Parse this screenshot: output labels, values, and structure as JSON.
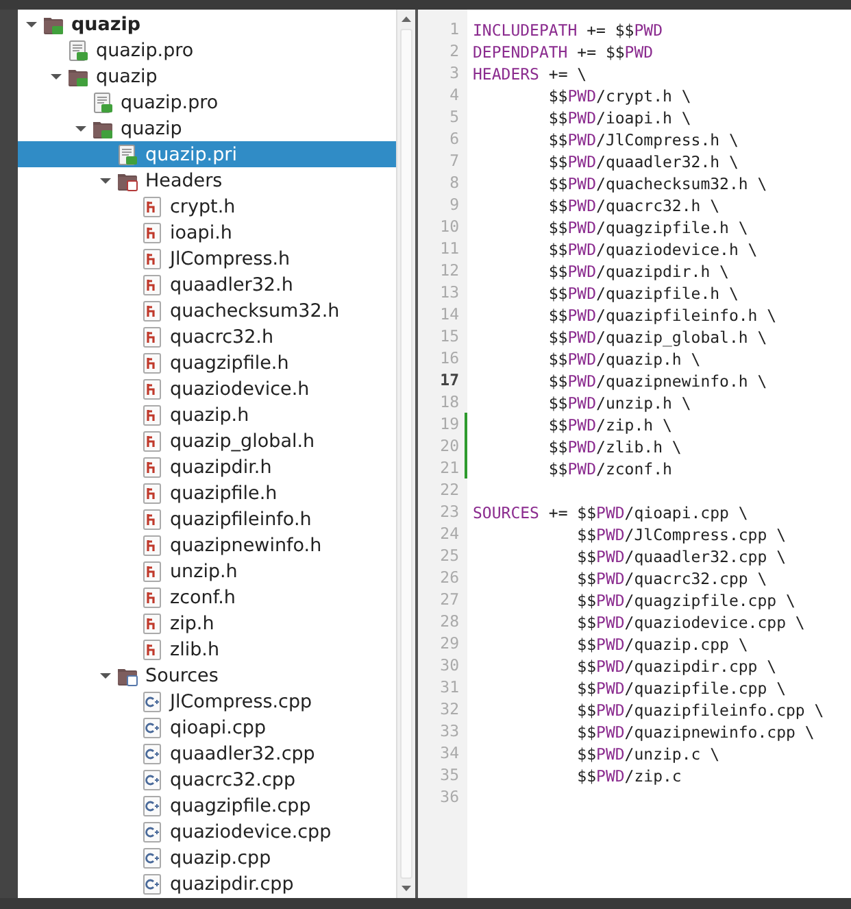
{
  "project_tree": [
    {
      "label": "quazip",
      "kind": "project",
      "bold": true,
      "expanded": true,
      "selected": false,
      "children": [
        {
          "label": "quazip.pro",
          "kind": "pro",
          "selected": false
        },
        {
          "label": "quazip",
          "kind": "project",
          "bold": false,
          "expanded": true,
          "selected": false,
          "children": [
            {
              "label": "quazip.pro",
              "kind": "pro",
              "selected": false
            },
            {
              "label": "quazip",
              "kind": "project",
              "bold": false,
              "expanded": true,
              "selected": false,
              "children": [
                {
                  "label": "quazip.pri",
                  "kind": "pro",
                  "selected": true
                },
                {
                  "label": "Headers",
                  "kind": "header-folder",
                  "bold": false,
                  "expanded": true,
                  "selected": false,
                  "children": [
                    {
                      "label": "crypt.h",
                      "kind": "header",
                      "selected": false
                    },
                    {
                      "label": "ioapi.h",
                      "kind": "header",
                      "selected": false
                    },
                    {
                      "label": "JlCompress.h",
                      "kind": "header",
                      "selected": false
                    },
                    {
                      "label": "quaadler32.h",
                      "kind": "header",
                      "selected": false
                    },
                    {
                      "label": "quachecksum32.h",
                      "kind": "header",
                      "selected": false
                    },
                    {
                      "label": "quacrc32.h",
                      "kind": "header",
                      "selected": false
                    },
                    {
                      "label": "quagzipfile.h",
                      "kind": "header",
                      "selected": false
                    },
                    {
                      "label": "quaziodevice.h",
                      "kind": "header",
                      "selected": false
                    },
                    {
                      "label": "quazip.h",
                      "kind": "header",
                      "selected": false
                    },
                    {
                      "label": "quazip_global.h",
                      "kind": "header",
                      "selected": false
                    },
                    {
                      "label": "quazipdir.h",
                      "kind": "header",
                      "selected": false
                    },
                    {
                      "label": "quazipfile.h",
                      "kind": "header",
                      "selected": false
                    },
                    {
                      "label": "quazipfileinfo.h",
                      "kind": "header",
                      "selected": false
                    },
                    {
                      "label": "quazipnewinfo.h",
                      "kind": "header",
                      "selected": false
                    },
                    {
                      "label": "unzip.h",
                      "kind": "header",
                      "selected": false
                    },
                    {
                      "label": "zconf.h",
                      "kind": "header",
                      "selected": false
                    },
                    {
                      "label": "zip.h",
                      "kind": "header",
                      "selected": false
                    },
                    {
                      "label": "zlib.h",
                      "kind": "header",
                      "selected": false
                    }
                  ]
                },
                {
                  "label": "Sources",
                  "kind": "source-folder",
                  "bold": false,
                  "expanded": true,
                  "selected": false,
                  "children": [
                    {
                      "label": "JlCompress.cpp",
                      "kind": "source",
                      "selected": false
                    },
                    {
                      "label": "qioapi.cpp",
                      "kind": "source",
                      "selected": false
                    },
                    {
                      "label": "quaadler32.cpp",
                      "kind": "source",
                      "selected": false
                    },
                    {
                      "label": "quacrc32.cpp",
                      "kind": "source",
                      "selected": false
                    },
                    {
                      "label": "quagzipfile.cpp",
                      "kind": "source",
                      "selected": false
                    },
                    {
                      "label": "quaziodevice.cpp",
                      "kind": "source",
                      "selected": false
                    },
                    {
                      "label": "quazip.cpp",
                      "kind": "source",
                      "selected": false
                    },
                    {
                      "label": "quazipdir.cpp",
                      "kind": "source",
                      "selected": false
                    }
                  ]
                }
              ]
            }
          ]
        }
      ]
    }
  ],
  "editor": {
    "lines": [
      {
        "number": "1",
        "current": false,
        "modified": false,
        "segments": [
          {
            "kind": "keyword",
            "text": "INCLUDEPATH"
          },
          {
            "kind": "plain",
            "text": " += $$"
          },
          {
            "kind": "keyword",
            "text": "PWD"
          }
        ]
      },
      {
        "number": "2",
        "current": false,
        "modified": false,
        "segments": [
          {
            "kind": "keyword",
            "text": "DEPENDPATH"
          },
          {
            "kind": "plain",
            "text": " += $$"
          },
          {
            "kind": "keyword",
            "text": "PWD"
          }
        ]
      },
      {
        "number": "3",
        "current": false,
        "modified": false,
        "segments": [
          {
            "kind": "keyword",
            "text": "HEADERS"
          },
          {
            "kind": "plain",
            "text": " += \\"
          }
        ]
      },
      {
        "number": "4",
        "current": false,
        "modified": false,
        "segments": [
          {
            "kind": "plain",
            "text": "        $$"
          },
          {
            "kind": "keyword",
            "text": "PWD"
          },
          {
            "kind": "plain",
            "text": "/crypt.h \\"
          }
        ]
      },
      {
        "number": "5",
        "current": false,
        "modified": false,
        "segments": [
          {
            "kind": "plain",
            "text": "        $$"
          },
          {
            "kind": "keyword",
            "text": "PWD"
          },
          {
            "kind": "plain",
            "text": "/ioapi.h \\"
          }
        ]
      },
      {
        "number": "6",
        "current": false,
        "modified": false,
        "segments": [
          {
            "kind": "plain",
            "text": "        $$"
          },
          {
            "kind": "keyword",
            "text": "PWD"
          },
          {
            "kind": "plain",
            "text": "/JlCompress.h \\"
          }
        ]
      },
      {
        "number": "7",
        "current": false,
        "modified": false,
        "segments": [
          {
            "kind": "plain",
            "text": "        $$"
          },
          {
            "kind": "keyword",
            "text": "PWD"
          },
          {
            "kind": "plain",
            "text": "/quaadler32.h \\"
          }
        ]
      },
      {
        "number": "8",
        "current": false,
        "modified": false,
        "segments": [
          {
            "kind": "plain",
            "text": "        $$"
          },
          {
            "kind": "keyword",
            "text": "PWD"
          },
          {
            "kind": "plain",
            "text": "/quachecksum32.h \\"
          }
        ]
      },
      {
        "number": "9",
        "current": false,
        "modified": false,
        "segments": [
          {
            "kind": "plain",
            "text": "        $$"
          },
          {
            "kind": "keyword",
            "text": "PWD"
          },
          {
            "kind": "plain",
            "text": "/quacrc32.h \\"
          }
        ]
      },
      {
        "number": "10",
        "current": false,
        "modified": false,
        "segments": [
          {
            "kind": "plain",
            "text": "        $$"
          },
          {
            "kind": "keyword",
            "text": "PWD"
          },
          {
            "kind": "plain",
            "text": "/quagzipfile.h \\"
          }
        ]
      },
      {
        "number": "11",
        "current": false,
        "modified": false,
        "segments": [
          {
            "kind": "plain",
            "text": "        $$"
          },
          {
            "kind": "keyword",
            "text": "PWD"
          },
          {
            "kind": "plain",
            "text": "/quaziodevice.h \\"
          }
        ]
      },
      {
        "number": "12",
        "current": false,
        "modified": false,
        "segments": [
          {
            "kind": "plain",
            "text": "        $$"
          },
          {
            "kind": "keyword",
            "text": "PWD"
          },
          {
            "kind": "plain",
            "text": "/quazipdir.h \\"
          }
        ]
      },
      {
        "number": "13",
        "current": false,
        "modified": false,
        "segments": [
          {
            "kind": "plain",
            "text": "        $$"
          },
          {
            "kind": "keyword",
            "text": "PWD"
          },
          {
            "kind": "plain",
            "text": "/quazipfile.h \\"
          }
        ]
      },
      {
        "number": "14",
        "current": false,
        "modified": false,
        "segments": [
          {
            "kind": "plain",
            "text": "        $$"
          },
          {
            "kind": "keyword",
            "text": "PWD"
          },
          {
            "kind": "plain",
            "text": "/quazipfileinfo.h \\"
          }
        ]
      },
      {
        "number": "15",
        "current": false,
        "modified": false,
        "segments": [
          {
            "kind": "plain",
            "text": "        $$"
          },
          {
            "kind": "keyword",
            "text": "PWD"
          },
          {
            "kind": "plain",
            "text": "/quazip_global.h \\"
          }
        ]
      },
      {
        "number": "16",
        "current": false,
        "modified": false,
        "segments": [
          {
            "kind": "plain",
            "text": "        $$"
          },
          {
            "kind": "keyword",
            "text": "PWD"
          },
          {
            "kind": "plain",
            "text": "/quazip.h \\"
          }
        ]
      },
      {
        "number": "17",
        "current": true,
        "modified": false,
        "segments": [
          {
            "kind": "plain",
            "text": "        $$"
          },
          {
            "kind": "keyword",
            "text": "PWD"
          },
          {
            "kind": "plain",
            "text": "/quazipnewinfo.h \\"
          }
        ]
      },
      {
        "number": "18",
        "current": false,
        "modified": false,
        "segments": [
          {
            "kind": "plain",
            "text": "        $$"
          },
          {
            "kind": "keyword",
            "text": "PWD"
          },
          {
            "kind": "plain",
            "text": "/unzip.h \\"
          }
        ]
      },
      {
        "number": "19",
        "current": false,
        "modified": true,
        "segments": [
          {
            "kind": "plain",
            "text": "        $$"
          },
          {
            "kind": "keyword",
            "text": "PWD"
          },
          {
            "kind": "plain",
            "text": "/zip.h \\"
          }
        ]
      },
      {
        "number": "20",
        "current": false,
        "modified": true,
        "segments": [
          {
            "kind": "plain",
            "text": "        $$"
          },
          {
            "kind": "keyword",
            "text": "PWD"
          },
          {
            "kind": "plain",
            "text": "/zlib.h \\"
          }
        ]
      },
      {
        "number": "21",
        "current": false,
        "modified": true,
        "segments": [
          {
            "kind": "plain",
            "text": "        $$"
          },
          {
            "kind": "keyword",
            "text": "PWD"
          },
          {
            "kind": "plain",
            "text": "/zconf.h"
          }
        ]
      },
      {
        "number": "22",
        "current": false,
        "modified": false
      },
      {
        "number": "23",
        "current": false,
        "modified": false,
        "segments": [
          {
            "kind": "keyword",
            "text": "SOURCES"
          },
          {
            "kind": "plain",
            "text": " += $$"
          },
          {
            "kind": "keyword",
            "text": "PWD"
          },
          {
            "kind": "plain",
            "text": "/qioapi.cpp \\"
          }
        ]
      },
      {
        "number": "24",
        "current": false,
        "modified": false,
        "segments": [
          {
            "kind": "plain",
            "text": "           $$"
          },
          {
            "kind": "keyword",
            "text": "PWD"
          },
          {
            "kind": "plain",
            "text": "/JlCompress.cpp \\"
          }
        ]
      },
      {
        "number": "25",
        "current": false,
        "modified": false,
        "segments": [
          {
            "kind": "plain",
            "text": "           $$"
          },
          {
            "kind": "keyword",
            "text": "PWD"
          },
          {
            "kind": "plain",
            "text": "/quaadler32.cpp \\"
          }
        ]
      },
      {
        "number": "26",
        "current": false,
        "modified": false,
        "segments": [
          {
            "kind": "plain",
            "text": "           $$"
          },
          {
            "kind": "keyword",
            "text": "PWD"
          },
          {
            "kind": "plain",
            "text": "/quacrc32.cpp \\"
          }
        ]
      },
      {
        "number": "27",
        "current": false,
        "modified": false,
        "segments": [
          {
            "kind": "plain",
            "text": "           $$"
          },
          {
            "kind": "keyword",
            "text": "PWD"
          },
          {
            "kind": "plain",
            "text": "/quagzipfile.cpp \\"
          }
        ]
      },
      {
        "number": "28",
        "current": false,
        "modified": false,
        "segments": [
          {
            "kind": "plain",
            "text": "           $$"
          },
          {
            "kind": "keyword",
            "text": "PWD"
          },
          {
            "kind": "plain",
            "text": "/quaziodevice.cpp \\"
          }
        ]
      },
      {
        "number": "29",
        "current": false,
        "modified": false,
        "segments": [
          {
            "kind": "plain",
            "text": "           $$"
          },
          {
            "kind": "keyword",
            "text": "PWD"
          },
          {
            "kind": "plain",
            "text": "/quazip.cpp \\"
          }
        ]
      },
      {
        "number": "30",
        "current": false,
        "modified": false,
        "segments": [
          {
            "kind": "plain",
            "text": "           $$"
          },
          {
            "kind": "keyword",
            "text": "PWD"
          },
          {
            "kind": "plain",
            "text": "/quazipdir.cpp \\"
          }
        ]
      },
      {
        "number": "31",
        "current": false,
        "modified": false,
        "segments": [
          {
            "kind": "plain",
            "text": "           $$"
          },
          {
            "kind": "keyword",
            "text": "PWD"
          },
          {
            "kind": "plain",
            "text": "/quazipfile.cpp \\"
          }
        ]
      },
      {
        "number": "32",
        "current": false,
        "modified": false,
        "segments": [
          {
            "kind": "plain",
            "text": "           $$"
          },
          {
            "kind": "keyword",
            "text": "PWD"
          },
          {
            "kind": "plain",
            "text": "/quazipfileinfo.cpp \\"
          }
        ]
      },
      {
        "number": "33",
        "current": false,
        "modified": false,
        "segments": [
          {
            "kind": "plain",
            "text": "           $$"
          },
          {
            "kind": "keyword",
            "text": "PWD"
          },
          {
            "kind": "plain",
            "text": "/quazipnewinfo.cpp \\"
          }
        ]
      },
      {
        "number": "34",
        "current": false,
        "modified": false,
        "segments": [
          {
            "kind": "plain",
            "text": "           $$"
          },
          {
            "kind": "keyword",
            "text": "PWD"
          },
          {
            "kind": "plain",
            "text": "/unzip.c \\"
          }
        ]
      },
      {
        "number": "35",
        "current": false,
        "modified": false,
        "segments": [
          {
            "kind": "plain",
            "text": "           $$"
          },
          {
            "kind": "keyword",
            "text": "PWD"
          },
          {
            "kind": "plain",
            "text": "/zip.c"
          }
        ]
      },
      {
        "number": "36",
        "current": false,
        "modified": false
      }
    ]
  }
}
